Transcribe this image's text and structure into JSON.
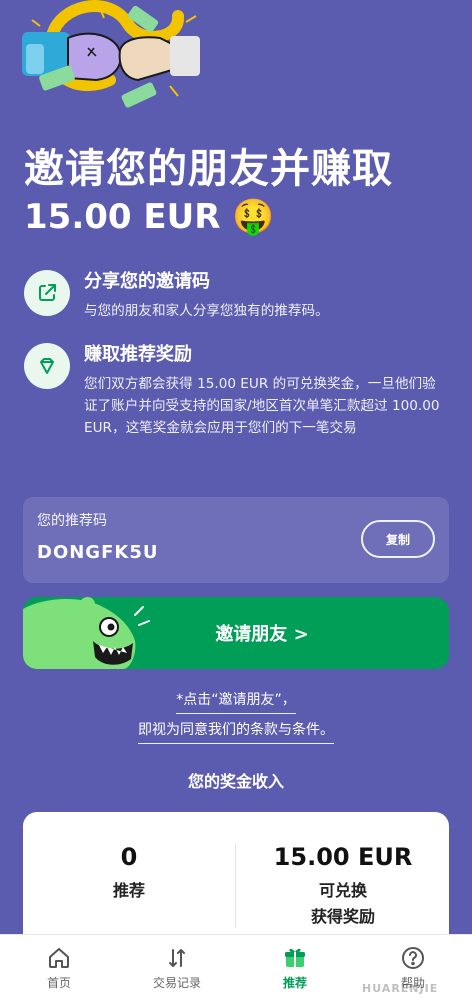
{
  "hero": {
    "title": "邀请您的朋友并赚取",
    "amount": "15.00 EUR",
    "emoji": "🤑"
  },
  "features": [
    {
      "icon": "share-icon",
      "title": "分享您的邀请码",
      "desc": "与您的朋友和家人分享您独有的推荐码。"
    },
    {
      "icon": "diamond-icon",
      "title": "赚取推荐奖励",
      "desc": "您们双方都会获得 15.00 EUR 的可兑换奖金，一旦他们验证了账户并向受支持的国家/地区首次单笔汇款超过 100.00 EUR，这笔奖金就会应用于您们的下一笔交易"
    }
  ],
  "referral": {
    "label": "您的推荐码",
    "code": "DONGFK5U",
    "copy_label": "复制"
  },
  "invite": {
    "label": "邀请朋友 >"
  },
  "terms": {
    "line1": "*点击“邀请朋友”，",
    "line2": "即视为同意我们的条款与条件。"
  },
  "earnings": {
    "title": "您的奖金收入",
    "left_value": "0",
    "left_label": "推荐",
    "right_value": "15.00 EUR",
    "right_label_line1": "可兑换",
    "right_label_line2": "获得奖励"
  },
  "nav": [
    {
      "label": "首页",
      "icon": "home-icon"
    },
    {
      "label": "交易记录",
      "icon": "transactions-icon"
    },
    {
      "label": "推荐",
      "icon": "gift-icon",
      "active": true
    },
    {
      "label": "帮助",
      "icon": "help-icon"
    }
  ],
  "watermark": {
    "text": "HUARENJIE"
  },
  "colors": {
    "background": "#5b5bb0",
    "accent_green": "#009e57",
    "card_white": "#ffffff"
  }
}
